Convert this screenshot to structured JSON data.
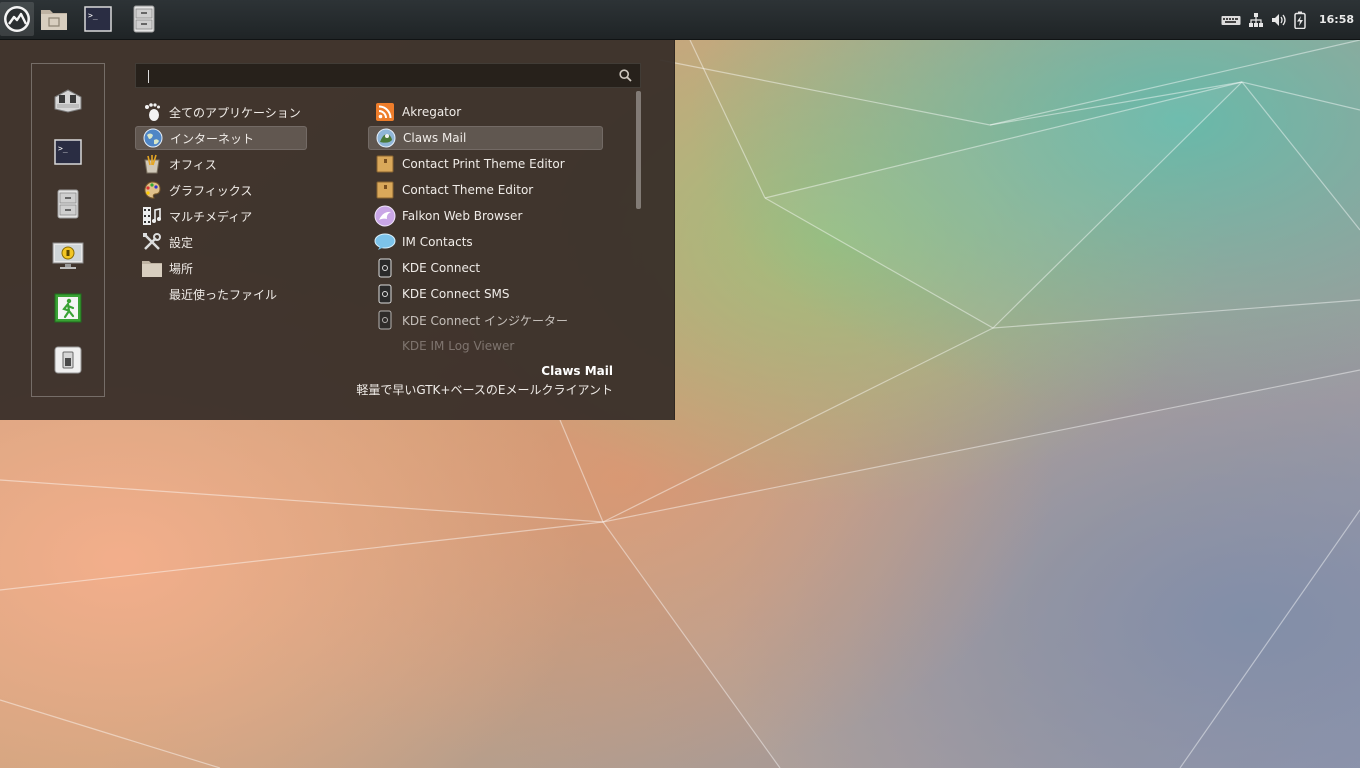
{
  "panel": {
    "launchers": [
      {
        "name": "menu",
        "icon": "cinnamon-logo-icon"
      },
      {
        "name": "file-manager",
        "icon": "folder-icon"
      },
      {
        "name": "terminal",
        "icon": "terminal-icon"
      },
      {
        "name": "file-cabinet",
        "icon": "cabinet-icon"
      }
    ],
    "tray": {
      "keyboard_icon": "keyboard-icon",
      "network_icon": "network-icon",
      "volume_icon": "volume-icon",
      "battery_icon": "battery-charging-icon",
      "clock": "16:58"
    }
  },
  "menu": {
    "search": {
      "value": "",
      "placeholder": ""
    },
    "sidebar": [
      {
        "name": "software-manager",
        "icon": "package-icon"
      },
      {
        "name": "terminal",
        "icon": "terminal-icon"
      },
      {
        "name": "files",
        "icon": "cabinet-icon"
      },
      {
        "name": "lock-screen",
        "icon": "lock-monitor-icon"
      },
      {
        "name": "logout",
        "icon": "exit-icon"
      },
      {
        "name": "shutdown",
        "icon": "power-switch-icon"
      }
    ],
    "categories": [
      {
        "label": "全てのアプリケーション",
        "icon": "gnome-foot-icon"
      },
      {
        "label": "インターネット",
        "icon": "globe-icon",
        "selected": true
      },
      {
        "label": "オフィス",
        "icon": "office-icon"
      },
      {
        "label": "グラフィックス",
        "icon": "palette-icon"
      },
      {
        "label": "マルチメディア",
        "icon": "multimedia-icon"
      },
      {
        "label": "設定",
        "icon": "settings-tools-icon"
      },
      {
        "label": "場所",
        "icon": "folder-icon"
      },
      {
        "label": "最近使ったファイル",
        "icon": ""
      }
    ],
    "apps": [
      {
        "label": "Akregator",
        "icon": "rss-icon"
      },
      {
        "label": "Claws Mail",
        "icon": "claws-mail-icon",
        "selected": true
      },
      {
        "label": "Contact Print Theme Editor",
        "icon": "contact-theme-icon"
      },
      {
        "label": "Contact Theme Editor",
        "icon": "contact-theme-icon"
      },
      {
        "label": "Falkon Web Browser",
        "icon": "falkon-icon"
      },
      {
        "label": "IM Contacts",
        "icon": "chat-bubble-icon"
      },
      {
        "label": "KDE Connect",
        "icon": "kde-connect-icon"
      },
      {
        "label": "KDE Connect SMS",
        "icon": "kde-connect-icon"
      },
      {
        "label": "KDE Connect インジケーター",
        "icon": "kde-connect-icon"
      },
      {
        "label": "KDE IM Log Viewer",
        "icon": ""
      }
    ],
    "description": {
      "title": "Claws Mail",
      "text": "軽量で早いGTK+ベースのEメールクライアント"
    }
  },
  "colors": {
    "menu_bg": "#372e28",
    "panel_bg": "#252a2c",
    "text": "#f0ece8"
  }
}
